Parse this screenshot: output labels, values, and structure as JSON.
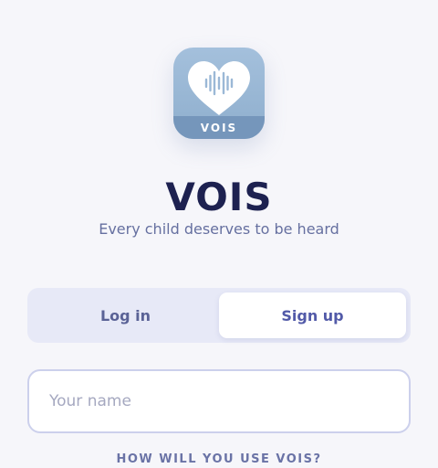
{
  "app_icon": {
    "icon": "heart-waveform-icon",
    "badge_text": "VOIS"
  },
  "brand": {
    "title": "VOIS",
    "tagline": "Every child deserves to be heard"
  },
  "auth_tabs": {
    "login_label": "Log in",
    "signup_label": "Sign up",
    "selected": "Sign up"
  },
  "name_input": {
    "placeholder": "Your name",
    "value": ""
  },
  "usage_section": {
    "label": "HOW WILL YOU USE VOIS?"
  },
  "colors": {
    "background": "#f6f6fa",
    "brand_navy": "#1d2150",
    "accent": "#525aa8",
    "icon_blue": "#8eaecd"
  }
}
